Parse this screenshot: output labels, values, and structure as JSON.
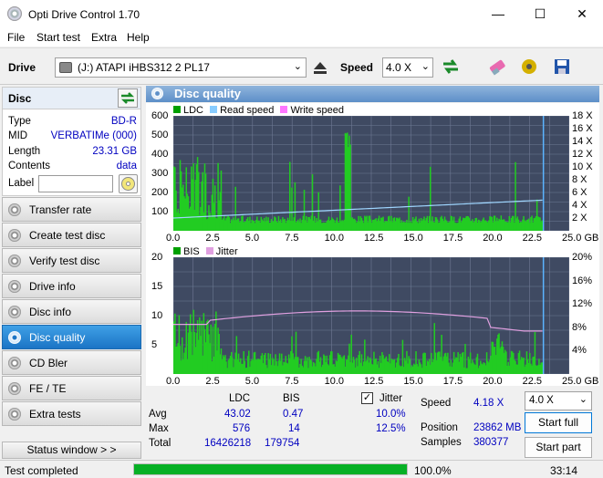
{
  "window": {
    "title": "Opti Drive Control 1.70",
    "minimize": "—",
    "maximize": "☐",
    "close": "✕"
  },
  "menu": [
    "File",
    "Start test",
    "Extra",
    "Help"
  ],
  "drive": {
    "label": "Drive",
    "device": "(J:)  ATAPI iHBS312  2 PL17",
    "speed_label": "Speed",
    "speed_value": "4.0 X"
  },
  "disc": {
    "title": "Disc",
    "fields": [
      {
        "k": "Type",
        "v": "BD-R"
      },
      {
        "k": "MID",
        "v": "VERBATIMe (000)"
      },
      {
        "k": "Length",
        "v": "23.31 GB"
      },
      {
        "k": "Contents",
        "v": "data"
      }
    ],
    "label_key": "Label",
    "label_value": ""
  },
  "nav": [
    "Transfer rate",
    "Create test disc",
    "Verify test disc",
    "Drive info",
    "Disc info",
    "Disc quality",
    "CD Bler",
    "FE / TE",
    "Extra tests"
  ],
  "nav_active": 5,
  "status_window": "Status window > >",
  "panel_title": "Disc quality",
  "chart_data": [
    {
      "type": "area",
      "legend": [
        "LDC",
        "Read speed",
        "Write speed"
      ],
      "x_ticks": [
        "0.0",
        "2.5",
        "5.0",
        "7.5",
        "10.0",
        "12.5",
        "15.0",
        "17.5",
        "20.0",
        "22.5",
        "25.0 GB"
      ],
      "y_ticks": [
        "600",
        "500",
        "400",
        "300",
        "200",
        "100"
      ],
      "y2_ticks": [
        "18 X",
        "16 X",
        "14 X",
        "12 X",
        "10 X",
        "8 X",
        "6 X",
        "4 X",
        "2 X"
      ],
      "xlim": [
        0,
        25
      ],
      "ylim": [
        0,
        600
      ],
      "y2lim": [
        0,
        18
      ],
      "grid": true,
      "data_end_gb": 23.31
    },
    {
      "type": "area",
      "legend": [
        "BIS",
        "Jitter"
      ],
      "x_ticks": [
        "0.0",
        "2.5",
        "5.0",
        "7.5",
        "10.0",
        "12.5",
        "15.0",
        "17.5",
        "20.0",
        "22.5",
        "25.0 GB"
      ],
      "y_ticks": [
        "20",
        "15",
        "10",
        "5"
      ],
      "y2_ticks": [
        "20%",
        "16%",
        "12%",
        "8%",
        "4%"
      ],
      "xlim": [
        0,
        25
      ],
      "ylim": [
        0,
        20
      ],
      "y2lim": [
        0,
        20
      ],
      "grid": true,
      "data_end_gb": 23.31
    }
  ],
  "stats": {
    "col_ldc": "LDC",
    "col_bis": "BIS",
    "jitter_label": "Jitter",
    "jitter_checked": "✓",
    "rows": [
      {
        "k": "Avg",
        "ldc": "43.02",
        "bis": "0.47",
        "jit": "10.0%"
      },
      {
        "k": "Max",
        "ldc": "576",
        "bis": "14",
        "jit": "12.5%"
      },
      {
        "k": "Total",
        "ldc": "16426218",
        "bis": "179754",
        "jit": ""
      }
    ],
    "speed_k": "Speed",
    "speed_v": "4.18 X",
    "position_k": "Position",
    "position_v": "23862 MB",
    "samples_k": "Samples",
    "samples_v": "380377",
    "speed_select": "4.0 X",
    "start_full": "Start full",
    "start_part": "Start part"
  },
  "statusbar": {
    "text": "Test completed",
    "percent": "100.0%",
    "progress": 1.0,
    "time": "33:14"
  },
  "colors": {
    "ldc": "#00c000",
    "read": "#88ccff",
    "write": "#ff77ff",
    "bis": "#00c000",
    "jitter": "#e0a0e0",
    "accent": "#1b74c5"
  }
}
